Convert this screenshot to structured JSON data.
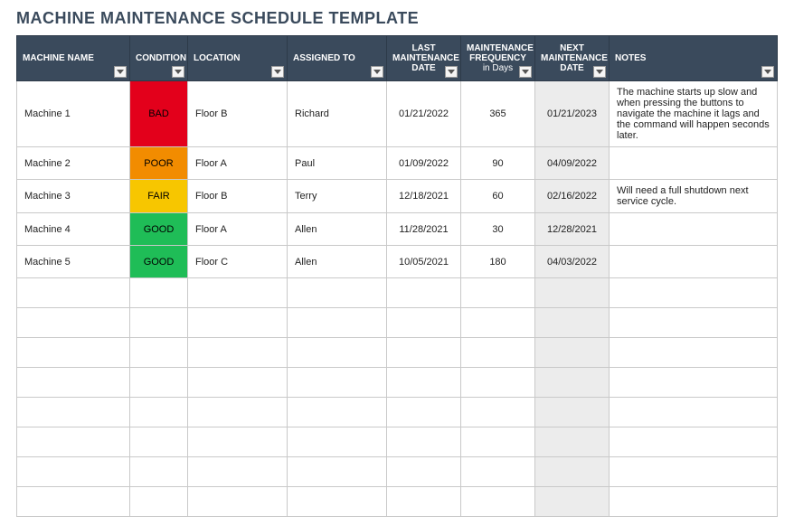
{
  "title": "MACHINE MAINTENANCE SCHEDULE TEMPLATE",
  "columns": {
    "machine_name": "MACHINE NAME",
    "condition": "CONDITION",
    "location": "LOCATION",
    "assigned_to": "ASSIGNED TO",
    "last_date": "LAST MAINTENANCE DATE",
    "frequency": "MAINTENANCE FREQUENCY",
    "frequency_sub": "in Days",
    "next_date": "NEXT MAINTENANCE DATE",
    "notes": "NOTES"
  },
  "condition_colors": {
    "BAD": "#e3001b",
    "POOR": "#f28c00",
    "FAIR": "#f7c600",
    "GOOD": "#1fbd57"
  },
  "rows": [
    {
      "machine_name": "Machine 1",
      "condition": "BAD",
      "location": "Floor B",
      "assigned_to": "Richard",
      "last_date": "01/21/2022",
      "frequency": "365",
      "next_date": "01/21/2023",
      "notes": "The machine starts up slow and when pressing the buttons to navigate the machine it lags and the command will happen seconds later."
    },
    {
      "machine_name": "Machine 2",
      "condition": "POOR",
      "location": "Floor A",
      "assigned_to": "Paul",
      "last_date": "01/09/2022",
      "frequency": "90",
      "next_date": "04/09/2022",
      "notes": ""
    },
    {
      "machine_name": "Machine 3",
      "condition": "FAIR",
      "location": "Floor B",
      "assigned_to": "Terry",
      "last_date": "12/18/2021",
      "frequency": "60",
      "next_date": "02/16/2022",
      "notes": "Will need a full shutdown next service cycle."
    },
    {
      "machine_name": "Machine 4",
      "condition": "GOOD",
      "location": "Floor A",
      "assigned_to": "Allen",
      "last_date": "11/28/2021",
      "frequency": "30",
      "next_date": "12/28/2021",
      "notes": ""
    },
    {
      "machine_name": "Machine 5",
      "condition": "GOOD",
      "location": "Floor C",
      "assigned_to": "Allen",
      "last_date": "10/05/2021",
      "frequency": "180",
      "next_date": "04/03/2022",
      "notes": ""
    }
  ],
  "empty_rows": 8
}
